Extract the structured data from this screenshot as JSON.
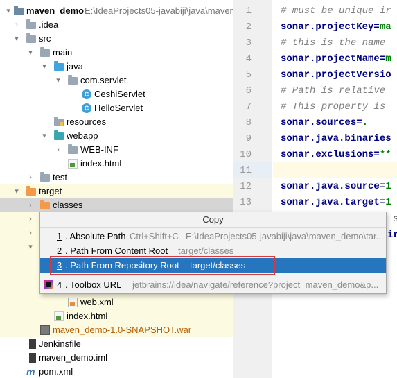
{
  "project_tree": {
    "root": {
      "name": "maven_demo",
      "path": "E:\\IdeaProjects05-javabiji\\java\\maven"
    },
    "items": [
      {
        "label": ".idea"
      },
      {
        "label": "src"
      },
      {
        "label": "main"
      },
      {
        "label": "java"
      },
      {
        "label": "com.servlet"
      },
      {
        "label": "CeshiServlet"
      },
      {
        "label": "HelloServlet"
      },
      {
        "label": "resources"
      },
      {
        "label": "webapp"
      },
      {
        "label": "WEB-INF"
      },
      {
        "label": "index.html"
      },
      {
        "label": "test"
      },
      {
        "label": "target"
      },
      {
        "label": "classes"
      },
      {
        "label": "web.xml"
      },
      {
        "label": "index.html"
      },
      {
        "label": "maven_demo-1.0-SNAPSHOT.war"
      },
      {
        "label": "Jenkinsfile"
      },
      {
        "label": "maven_demo.iml"
      },
      {
        "label": "pom.xml"
      }
    ],
    "class_icon_letter": "C"
  },
  "editor": {
    "lines": [
      {
        "n": "1",
        "comment": "# must be unique ir"
      },
      {
        "n": "2",
        "key": "sonar.projectKey=",
        "value": "ma"
      },
      {
        "n": "3",
        "comment": "# this is the name"
      },
      {
        "n": "4",
        "key": "sonar.projectName=",
        "value": "m"
      },
      {
        "n": "5",
        "key": "sonar.projectVersio",
        "value": ""
      },
      {
        "n": "6",
        "comment": "# Path is relative"
      },
      {
        "n": "7",
        "comment": "# This property is"
      },
      {
        "n": "8",
        "key": "sonar.sources=",
        "value": "."
      },
      {
        "n": "9",
        "key": "sonar.java.binaries",
        "value": ""
      },
      {
        "n": "10",
        "key": "sonar.exclusions=",
        "value": "**"
      },
      {
        "n": "11",
        "key": "",
        "value": ""
      },
      {
        "n": "12",
        "key": "sonar.java.source=",
        "value": "1"
      },
      {
        "n": "13",
        "key": "sonar.java.target=",
        "value": "1"
      }
    ],
    "peek_fragments": [
      "s",
      "ir"
    ]
  },
  "context_menu": {
    "title": "Copy",
    "items": [
      {
        "num": "1",
        "label": ". Absolute Path",
        "shortcut": "Ctrl+Shift+C",
        "hint": "E:\\IdeaProjects05-javabiji\\java\\maven_demo\\tar..."
      },
      {
        "num": "2",
        "label": ". Path From Content Root",
        "hint": "target/classes"
      },
      {
        "num": "3",
        "label": ". Path From Repository Root",
        "hint": "target/classes"
      },
      {
        "num": "4",
        "label": ". Toolbox URL",
        "hint": "jetbrains://idea/navigate/reference?project=maven_demo&p..."
      }
    ],
    "selected_index": 2
  },
  "colors": {
    "selection": "#2675bf",
    "highlight_box": "#d63a3a",
    "excluded_folder_bg": "#fcfae0",
    "key_color": "#000080",
    "value_color": "#008000"
  }
}
